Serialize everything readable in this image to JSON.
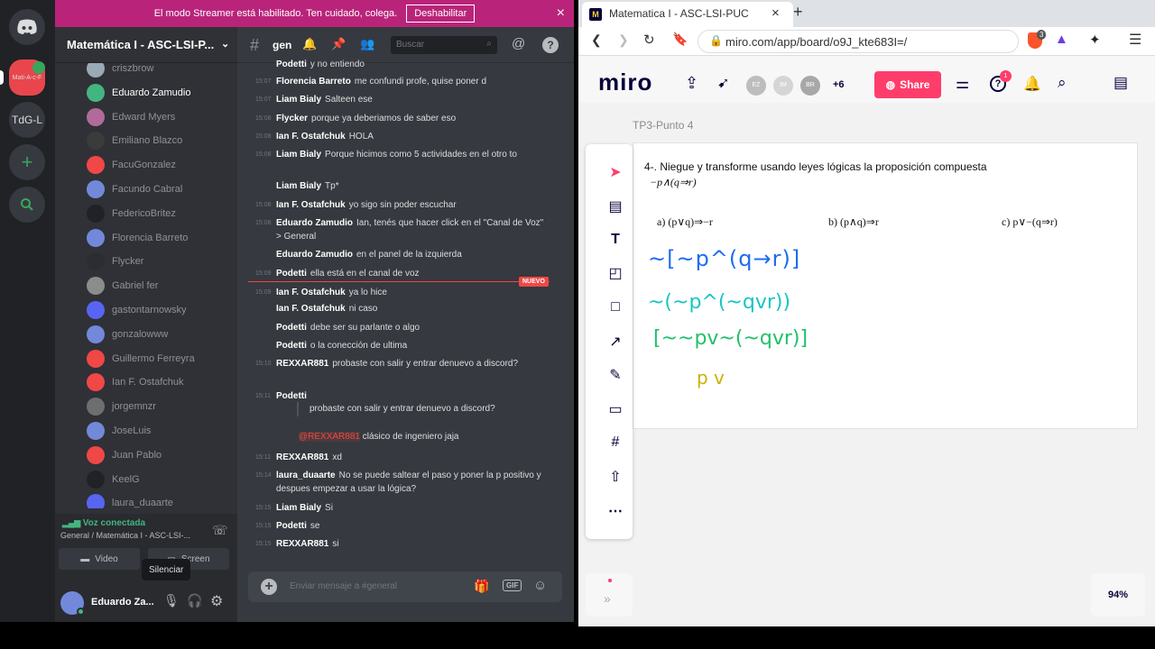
{
  "streamer_banner": {
    "text": "El modo Streamer está habilitado. Ten cuidado, colega.",
    "button": "Deshabilitar",
    "close": "×"
  },
  "guilds": {
    "items": [
      "Mati-A-c-F",
      "TdG-L"
    ]
  },
  "server": {
    "name": "Matemática I - ASC-LSI-P...",
    "channel": "gen",
    "search_placeholder": "Buscar"
  },
  "members": [
    {
      "name": "criszbrow",
      "color": "#99aab5"
    },
    {
      "name": "Eduardo Zamudio",
      "color": "#43b581",
      "active": true
    },
    {
      "name": "Edward Myers",
      "color": "#b06b9a"
    },
    {
      "name": "Emiliano Blazco",
      "color": "#3b3b3b"
    },
    {
      "name": "FacuGonzalez",
      "color": "#f04747"
    },
    {
      "name": "Facundo Cabral",
      "color": "#7289da"
    },
    {
      "name": "FedericoBritez",
      "color": "#202225"
    },
    {
      "name": "Florencia Barreto",
      "color": "#7289da"
    },
    {
      "name": "Flycker",
      "color": "#2b2d31"
    },
    {
      "name": "Gabriel fer",
      "color": "#8c8c8c"
    },
    {
      "name": "gastontarnowsky",
      "color": "#5865f2"
    },
    {
      "name": "gonzalowww",
      "color": "#7289da"
    },
    {
      "name": "Guillermo Ferreyra",
      "color": "#f04747"
    },
    {
      "name": "Ian F. Ostafchuk",
      "color": "#f04747"
    },
    {
      "name": "jorgemnzr",
      "color": "#6e6e6e"
    },
    {
      "name": "JoseLuis",
      "color": "#7289da"
    },
    {
      "name": "Juan Pablo",
      "color": "#f04747"
    },
    {
      "name": "KeelG",
      "color": "#202225"
    },
    {
      "name": "laura_duaarte",
      "color": "#5865f2"
    }
  ],
  "voice": {
    "status": "Voz conectada",
    "channel": "General / Matemática I - ASC-LSI-...",
    "video": "Video",
    "screen": "Screen",
    "tooltip": "Silenciar"
  },
  "user": {
    "name": "Eduardo Za..."
  },
  "messages": [
    {
      "time": "",
      "author": "Podetti",
      "text": "y no entiendo"
    },
    {
      "time": "15:07",
      "author": "Florencia Barreto",
      "text": "me confundi profe, quise poner d"
    },
    {
      "time": "15:07",
      "author": "Liam Bialy",
      "text": "Salteen ese"
    },
    {
      "time": "15:08",
      "author": "Flycker",
      "text": "porque ya deberiamos de saber eso"
    },
    {
      "time": "15:08",
      "author": "Ian F. Ostafchuk",
      "text": "HOLA"
    },
    {
      "time": "15:08",
      "author": "Liam Bialy",
      "text": "Porque hicimos como 5 actividades en el otro to"
    },
    {
      "time": "",
      "author": "Liam Bialy",
      "text": "Tp*"
    },
    {
      "time": "15:08",
      "author": "Ian F. Ostafchuk",
      "text": "yo sigo sin poder escuchar"
    },
    {
      "time": "15:08",
      "author": "Eduardo Zamudio",
      "text": "Ian, tenés que hacer click en el \"Canal de Voz\" > General"
    },
    {
      "time": "",
      "author": "Eduardo Zamudio",
      "text": "en el panel de la izquierda"
    },
    {
      "time": "15:09",
      "author": "Podetti",
      "text": "ella está en el canal de voz"
    },
    {
      "time": "15:09",
      "author": "Ian F. Ostafchuk",
      "text": "ya lo hice"
    },
    {
      "time": "",
      "author": "Ian F. Ostafchuk",
      "text": "ni caso"
    },
    {
      "time": "",
      "author": "Podetti",
      "text": "debe ser su parlante o algo"
    },
    {
      "time": "",
      "author": "Podetti",
      "text": "o la conección de ultima"
    },
    {
      "time": "15:10",
      "author": "REXXAR881",
      "text": "probaste con salir y entrar denuevo a discord?"
    },
    {
      "time": "15:11",
      "author": "Podetti",
      "text": ""
    },
    {
      "time": "15:11",
      "author": "REXXAR881",
      "text": "xd"
    },
    {
      "time": "15:14",
      "author": "laura_duaarte",
      "text": "No se puede saltear el paso y poner la p positivo y despues empezar a usar la lógica?"
    },
    {
      "time": "15:15",
      "author": "Liam Bialy",
      "text": "Si"
    },
    {
      "time": "15:15",
      "author": "Podetti",
      "text": "se"
    },
    {
      "time": "15:15",
      "author": "REXXAR881",
      "text": "si"
    }
  ],
  "quote": {
    "text": "probaste con salir y entrar denuevo a discord?",
    "mention": "@REXXAR881",
    "reply": "clásico de ingeniero jaja"
  },
  "new_badge": "NUEVO",
  "composer": {
    "placeholder": "Enviar mensaje a #general",
    "gif": "GIF"
  },
  "browser": {
    "tab_title": "Matematica I - ASC-LSI-PUC",
    "url": "miro.com/app/board/o9J_kte683I=/",
    "new_tab": "+",
    "close": "×",
    "ext_badge": "3"
  },
  "miro": {
    "logo": "miro",
    "avatars": [
      "EZ",
      "IM",
      "BR"
    ],
    "more": "+6",
    "share": "Share",
    "help_badge": "1",
    "frame_label": "TP3-Punto 4",
    "zoom": "94%",
    "problem": {
      "title": "4-. Niegue y transforme usando leyes lógicas la proposición compuesta",
      "prop": "−p∧(q⇒r)",
      "a": "a) (p∨q)⇒−r",
      "b": "b) (p∧q)⇒r",
      "c": "c) p∨−(q⇒r)"
    },
    "hand": {
      "line1": "~[~p^(q→r)]",
      "line2": "~(~p^(~qvr))",
      "line3": "[~~pv~(~qvr)]",
      "line4": "p v"
    },
    "accent": "#ff3d6a"
  }
}
